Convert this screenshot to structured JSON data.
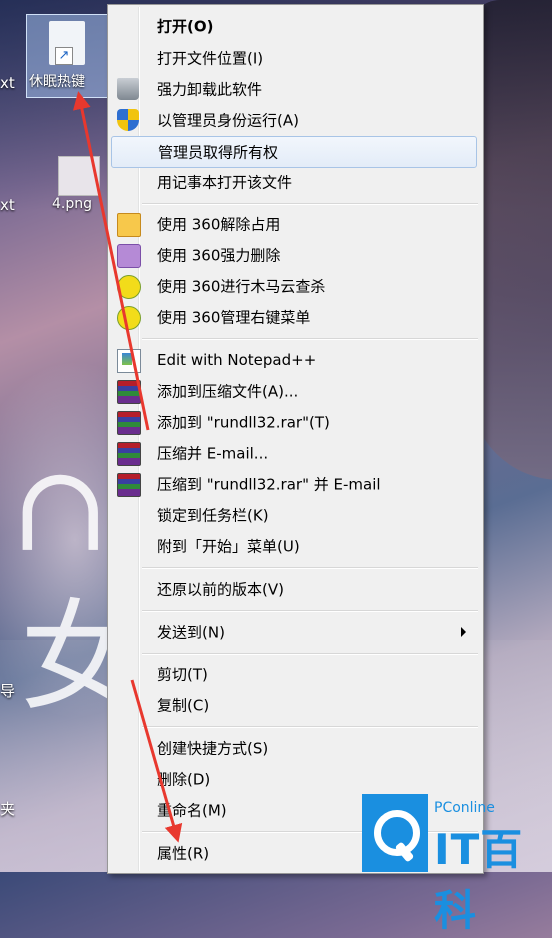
{
  "desktop": {
    "shortcut_label": "休眠热键",
    "png_label": "4.png",
    "left_text": [
      "xt",
      "xt",
      "导",
      "夹"
    ]
  },
  "menu": {
    "items": [
      {
        "label": "打开(O)",
        "icon": "",
        "bold": true
      },
      {
        "label": "打开文件位置(I)",
        "icon": ""
      },
      {
        "label": "强力卸载此软件",
        "icon": "trash-icon"
      },
      {
        "label": "以管理员身份运行(A)",
        "icon": "uac-shield-icon"
      },
      {
        "label": "管理员取得所有权",
        "icon": "",
        "highlighted": true
      },
      {
        "label": "用记事本打开该文件",
        "icon": ""
      },
      {
        "label": "使用 360解除占用",
        "icon": "360-unlock-icon"
      },
      {
        "label": "使用 360强力删除",
        "icon": "360-shred-icon"
      },
      {
        "label": "使用 360进行木马云查杀",
        "icon": "360-scan-icon"
      },
      {
        "label": "使用 360管理右键菜单",
        "icon": "360-menu-icon"
      },
      {
        "label": "Edit with Notepad++",
        "icon": "notepadpp-icon"
      },
      {
        "label": "添加到压缩文件(A)...",
        "icon": "winrar-icon"
      },
      {
        "label": "添加到 \"rundll32.rar\"(T)",
        "icon": "winrar-icon"
      },
      {
        "label": "压缩并 E-mail...",
        "icon": "winrar-icon"
      },
      {
        "label": "压缩到 \"rundll32.rar\" 并 E-mail",
        "icon": "winrar-icon"
      },
      {
        "label": "锁定到任务栏(K)",
        "icon": ""
      },
      {
        "label": "附到「开始」菜单(U)",
        "icon": ""
      },
      {
        "label": "还原以前的版本(V)",
        "icon": ""
      },
      {
        "label": "发送到(N)",
        "icon": "",
        "submenu": true
      },
      {
        "label": "剪切(T)",
        "icon": ""
      },
      {
        "label": "复制(C)",
        "icon": ""
      },
      {
        "label": "创建快捷方式(S)",
        "icon": ""
      },
      {
        "label": "删除(D)",
        "icon": ""
      },
      {
        "label": "重命名(M)",
        "icon": ""
      },
      {
        "label": "属性(R)",
        "icon": ""
      }
    ]
  },
  "watermark": {
    "small": "PConline",
    "big": "IT百科"
  },
  "colors": {
    "annotation_arrow": "#e8382e",
    "watermark": "#1a8fe0"
  }
}
